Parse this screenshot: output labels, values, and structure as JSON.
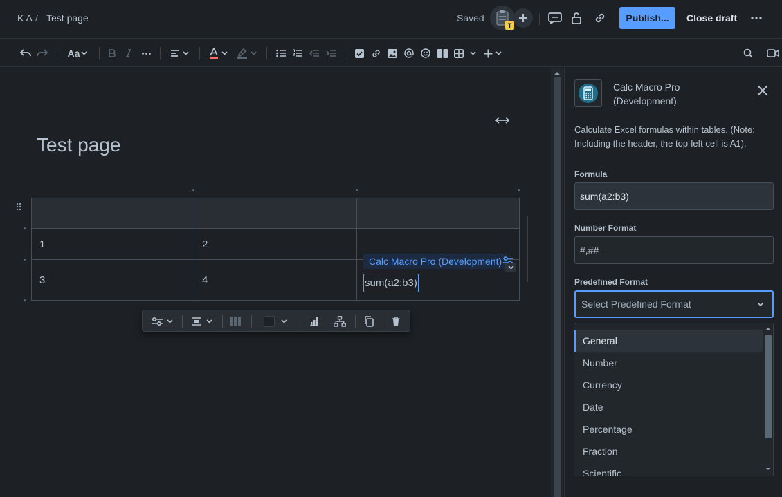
{
  "breadcrumb": {
    "space": "K A",
    "separator": "/",
    "page": "Test page"
  },
  "header": {
    "status": "Saved",
    "avatar_badge": "T",
    "publish_label": "Publish...",
    "close_draft_label": "Close draft"
  },
  "toolbar": {
    "text_style_label": "Aa"
  },
  "editor": {
    "title": "Test page",
    "table": {
      "rows": [
        [
          "",
          "",
          ""
        ],
        [
          "1",
          "2",
          ""
        ],
        [
          "3",
          "4",
          ""
        ]
      ]
    },
    "macro": {
      "name": "Calc Macro Pro (Development)",
      "value": "sum(a2:b3)"
    }
  },
  "panel": {
    "title_line1": "Calc Macro Pro",
    "title_line2": "(Development)",
    "description": "Calculate Excel formulas within tables. (Note: Including the header, the top-left cell is A1).",
    "formula_label": "Formula",
    "formula_value": "sum(a2:b3)",
    "number_format_label": "Number Format",
    "number_format_value": "#,##",
    "predefined_label": "Predefined Format",
    "predefined_placeholder": "Select Predefined Format",
    "options": [
      "General",
      "Number",
      "Currency",
      "Date",
      "Percentage",
      "Fraction",
      "Scientific"
    ],
    "selected_option": "General"
  },
  "colors": {
    "accent": "#579dff",
    "background": "#1d2125",
    "surface": "#22272b",
    "text": "#b6c2cf"
  }
}
